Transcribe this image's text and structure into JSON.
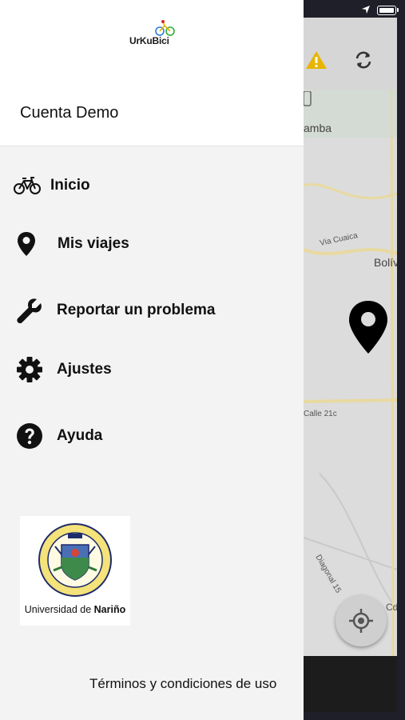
{
  "drawer": {
    "logo_text": "UrKuBici",
    "account_name": "Cuenta Demo",
    "menu": [
      {
        "label": "Inicio",
        "icon": "bicycle-icon"
      },
      {
        "label": "Mis viajes",
        "icon": "map-pin-icon"
      },
      {
        "label": "Reportar un problema",
        "icon": "wrench-icon"
      },
      {
        "label": "Ajustes",
        "icon": "gear-icon"
      },
      {
        "label": "Ayuda",
        "icon": "help-icon"
      }
    ],
    "university": {
      "name_prefix": "Universidad de ",
      "name_bold": "Nariño"
    },
    "terms_label": "Términos y condiciones de uso"
  },
  "map": {
    "labels": [
      "amba",
      "Via Cuaica",
      "Bolív",
      "Calle 21c",
      "Diagonal 15",
      "Cdi"
    ]
  },
  "colors": {
    "drawer_bg": "#f3f3f3",
    "header_bg": "#ffffff",
    "warning": "#e8b400",
    "map_bg": "#dcdcdc",
    "road": "#e8d9a0"
  }
}
